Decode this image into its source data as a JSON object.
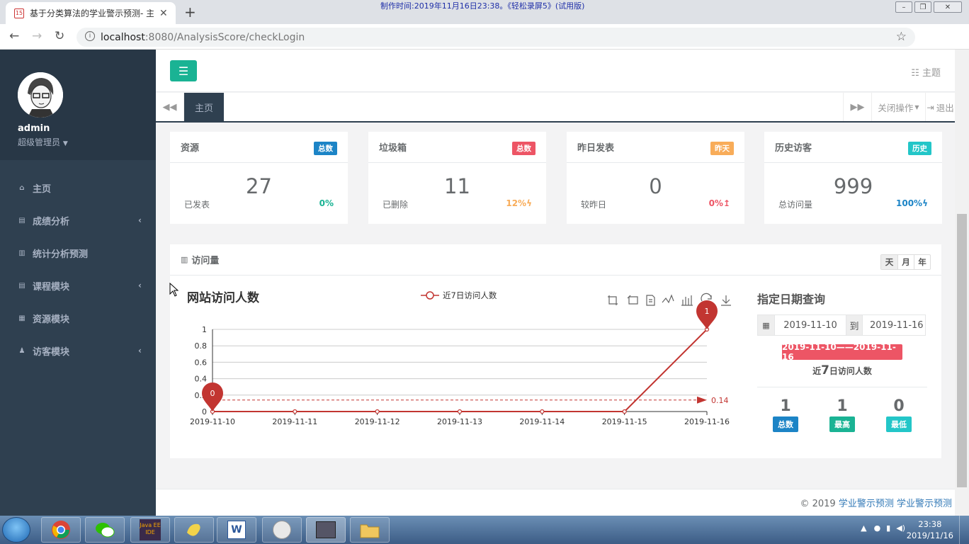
{
  "browser": {
    "tab_title": "基于分类算法的学业警示预测- 主",
    "tab_favicon": "15",
    "url_host": "localhost",
    "url_path": ":8080/AnalysisScore/checkLogin",
    "recording_banner": "制作时间:2019年11月16日23:38。《轻松录屏5》(试用版)"
  },
  "sidebar": {
    "username": "admin",
    "role": "超级管理员",
    "items": [
      {
        "label": "主页",
        "icon": "home-icon",
        "has_submenu": false
      },
      {
        "label": "成绩分析",
        "icon": "book-icon",
        "has_submenu": true
      },
      {
        "label": "统计分析预测",
        "icon": "bar-chart-icon",
        "has_submenu": false
      },
      {
        "label": "课程模块",
        "icon": "book-icon",
        "has_submenu": true
      },
      {
        "label": "资源模块",
        "icon": "table-icon",
        "has_submenu": false
      },
      {
        "label": "访客模块",
        "icon": "user-icon",
        "has_submenu": true
      }
    ]
  },
  "topbar": {
    "theme_label": "主题"
  },
  "tabs": {
    "home_label": "主页",
    "close_ops_label": "关闭操作",
    "logout_label": "退出"
  },
  "cards": [
    {
      "title": "资源",
      "badge": "总数",
      "badge_color": "#1c84c6",
      "value": "27",
      "sub": "已发表",
      "pct": "0%",
      "pct_color": "#1ab394"
    },
    {
      "title": "垃圾箱",
      "badge": "总数",
      "badge_color": "#ed5565",
      "value": "11",
      "sub": "已删除",
      "pct": "12%ϟ",
      "pct_color": "#f8ac59"
    },
    {
      "title": "昨日发表",
      "badge": "昨天",
      "badge_color": "#f8ac59",
      "value": "0",
      "sub": "较昨日",
      "pct": "0%↥",
      "pct_color": "#ed5565"
    },
    {
      "title": "历史访客",
      "badge": "历史",
      "badge_color": "#23c6c8",
      "value": "999",
      "sub": "总访问量",
      "pct": "100%ϟ",
      "pct_color": "#1c84c6"
    }
  ],
  "visits_panel": {
    "title": "访问量",
    "buttons": [
      "天",
      "月",
      "年"
    ]
  },
  "chart_data": {
    "type": "line",
    "title": "网站访问人数",
    "x": [
      "2019-11-10",
      "2019-11-11",
      "2019-11-12",
      "2019-11-13",
      "2019-11-14",
      "2019-11-15",
      "2019-11-16"
    ],
    "series": [
      {
        "name": "近7日访问人数",
        "values": [
          0,
          0,
          0,
          0,
          0,
          0,
          1
        ],
        "color": "#c23531"
      }
    ],
    "ylim": [
      0,
      1
    ],
    "yticks": [
      "0",
      "0.2",
      "0.4",
      "0.6",
      "0.8",
      "1"
    ],
    "mark_points": [
      {
        "label": "1",
        "x": "2019-11-16",
        "y": 1
      },
      {
        "label": "0",
        "x": "2019-11-10",
        "y": 0
      }
    ],
    "mark_line": {
      "label": "0.14",
      "y": 0.14
    },
    "grid": true,
    "legend_position": "top-center"
  },
  "query": {
    "title": "指定日期查询",
    "start_date": "2019-11-10",
    "to_label": "到",
    "end_date": "2019-11-16",
    "range_label": "2019-11-10——2019-11-16",
    "recent_prefix": "近",
    "recent_days": "7",
    "recent_suffix": "日访问人数",
    "stats": [
      {
        "value": "1",
        "label": "总数",
        "color": "#1c84c6"
      },
      {
        "value": "1",
        "label": "最高",
        "color": "#1ab394"
      },
      {
        "value": "0",
        "label": "最低",
        "color": "#23c6c8"
      }
    ]
  },
  "footer": {
    "copyright": "© 2019",
    "link1": "学业警示预测",
    "link2": "学业警示预测"
  },
  "taskbar": {
    "time": "23:38",
    "date": "2019/11/16",
    "app_icons": [
      "chrome-icon",
      "wechat-icon",
      "java-ee-ide-icon",
      "paint-icon",
      "word-icon",
      "image-icon",
      "recorder-icon",
      "folder-icon"
    ]
  }
}
